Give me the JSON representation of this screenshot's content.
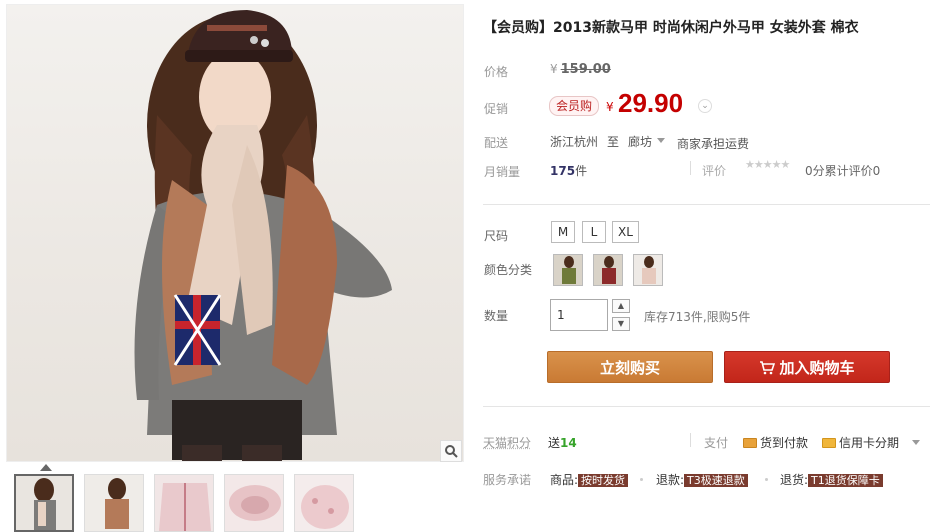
{
  "product": {
    "title": "【会员购】2013新款马甲 时尚休闲户外马甲 女装外套 棉衣"
  },
  "price": {
    "label": "价格",
    "currency": "¥",
    "original": "159.00"
  },
  "promotion": {
    "label": "促销",
    "badge": "会员购",
    "currency": "¥",
    "price": "29.90",
    "toggle_icon": "chevron-down-icon"
  },
  "shipping": {
    "label": "配送",
    "from": "浙江杭州",
    "to_word": "至",
    "to": "廊坊",
    "fee": "商家承担运费"
  },
  "sales": {
    "label": "月销量",
    "count": "175",
    "unit": "件",
    "rating_label": "评价",
    "stars": "★★★★★",
    "rating_text": "0分累计评价0"
  },
  "size": {
    "label": "尺码",
    "options": [
      "M",
      "L",
      "XL"
    ]
  },
  "color": {
    "label": "颜色分类"
  },
  "quantity": {
    "label": "数量",
    "value": "1",
    "stock": "库存713件,限购5件"
  },
  "actions": {
    "buy_now": "立刻购买",
    "add_to_cart": "加入购物车",
    "cart_icon": "cart-icon"
  },
  "points": {
    "label": "天猫积分",
    "prefix": "送",
    "value": "14"
  },
  "payment": {
    "label": "支付",
    "items": [
      "货到付款",
      "信用卡分期"
    ]
  },
  "service": {
    "label": "服务承诺",
    "items": [
      {
        "prefix": "商品:",
        "tag": "按时发货"
      },
      {
        "prefix": "退款:",
        "tag": "T3极速退款"
      },
      {
        "prefix": "退货:",
        "tag": "T1退货保障卡"
      }
    ]
  },
  "colors": {
    "accent_red": "#c40000",
    "buy_orange": "#c97a34",
    "cart_red": "#c2261a",
    "points_green": "#36a32a",
    "service_tag": "#7a3b2e"
  }
}
